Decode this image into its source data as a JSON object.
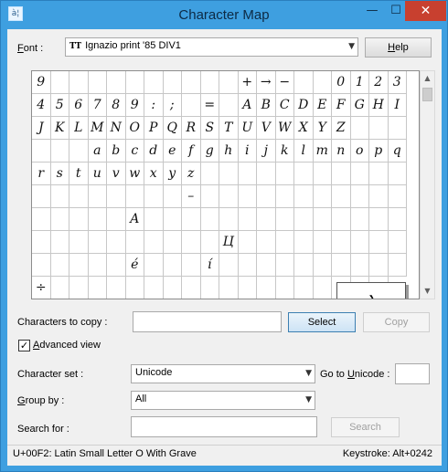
{
  "window": {
    "title": "Character Map",
    "icon_glyph": "à¦",
    "controls": {
      "minimize": "—",
      "maximize": "☐",
      "close": "✕"
    }
  },
  "font": {
    "label_prefix": "F",
    "label_rest": "ont :",
    "value": "Ignazio print '85 DIV1",
    "type_icon": "TT"
  },
  "help_button": {
    "label_prefix": "H",
    "label_rest": "elp"
  },
  "grid": {
    "cells": [
      "9",
      "",
      "",
      "",
      "",
      "",
      "",
      "",
      "",
      "",
      "",
      "+",
      "→",
      "−",
      "",
      "",
      "0",
      "1",
      "2",
      "3",
      "4",
      "5",
      "6",
      "7",
      "8",
      "9",
      ":",
      ";",
      "",
      "=",
      "",
      "A",
      "B",
      "C",
      "D",
      "E",
      "F",
      "G",
      "H",
      "I",
      "J",
      "K",
      "L",
      "M",
      "N",
      "O",
      "P",
      "Q",
      "R",
      "S",
      "T",
      "U",
      "V",
      "W",
      "X",
      "Y",
      "Z",
      "",
      "",
      "",
      "",
      "",
      "",
      "a",
      "b",
      "c",
      "d",
      "e",
      "f",
      "g",
      "h",
      "i",
      "j",
      "k",
      "l",
      "m",
      "n",
      "o",
      "p",
      "q",
      "r",
      "s",
      "t",
      "u",
      "v",
      "w",
      "x",
      "y",
      "z",
      "",
      "",
      "",
      "",
      "",
      "",
      "",
      "",
      "",
      "",
      "",
      "",
      "",
      "",
      "",
      "",
      "",
      "",
      "",
      "–",
      "",
      "",
      "",
      "",
      "",
      "",
      "",
      "",
      "",
      "",
      "",
      "",
      "",
      "",
      "",
      "",
      "A",
      "",
      "",
      "",
      "",
      "",
      "",
      "",
      "",
      "",
      "",
      "",
      "",
      "",
      "",
      "",
      "",
      "",
      "",
      "",
      "",
      "",
      "",
      "",
      "",
      "Ц",
      "",
      "",
      "",
      "",
      "",
      "",
      "",
      "",
      "",
      "",
      "",
      "",
      "",
      "",
      "é",
      "",
      "",
      "",
      "í",
      "",
      "",
      "",
      "",
      "",
      "",
      "",
      "",
      "",
      "",
      "÷",
      "",
      "",
      "",
      "",
      "",
      "",
      "",
      "",
      "",
      "",
      "",
      "",
      "",
      "",
      "",
      "",
      "",
      ""
    ],
    "enlarged_char": "ò"
  },
  "scrollbar": {
    "up": "▲",
    "down": "▼"
  },
  "copy_area": {
    "label": "Characters to copy :",
    "value": "",
    "select_label": "Select",
    "copy_label": "Copy"
  },
  "advanced_view": {
    "label_prefix": "A",
    "label_rest": "dvanced view",
    "checked_mark": "✓"
  },
  "character_set": {
    "label": "Character set :",
    "value": "Unicode"
  },
  "goto_unicode": {
    "label_prefix": "Go to ",
    "label_u": "U",
    "label_rest": "nicode :",
    "value": ""
  },
  "group_by": {
    "label_prefix": "G",
    "label_rest": "roup by :",
    "value": "All"
  },
  "search": {
    "label": "Search for :",
    "value": "",
    "button_label": "Search"
  },
  "status": {
    "left": "U+00F2: Latin Small Letter O With Grave",
    "right": "Keystroke: Alt+0242"
  },
  "colors": {
    "title_bar": "#3e9fe0",
    "close_button": "#c8402f",
    "client_bg": "#f0f0f0"
  }
}
